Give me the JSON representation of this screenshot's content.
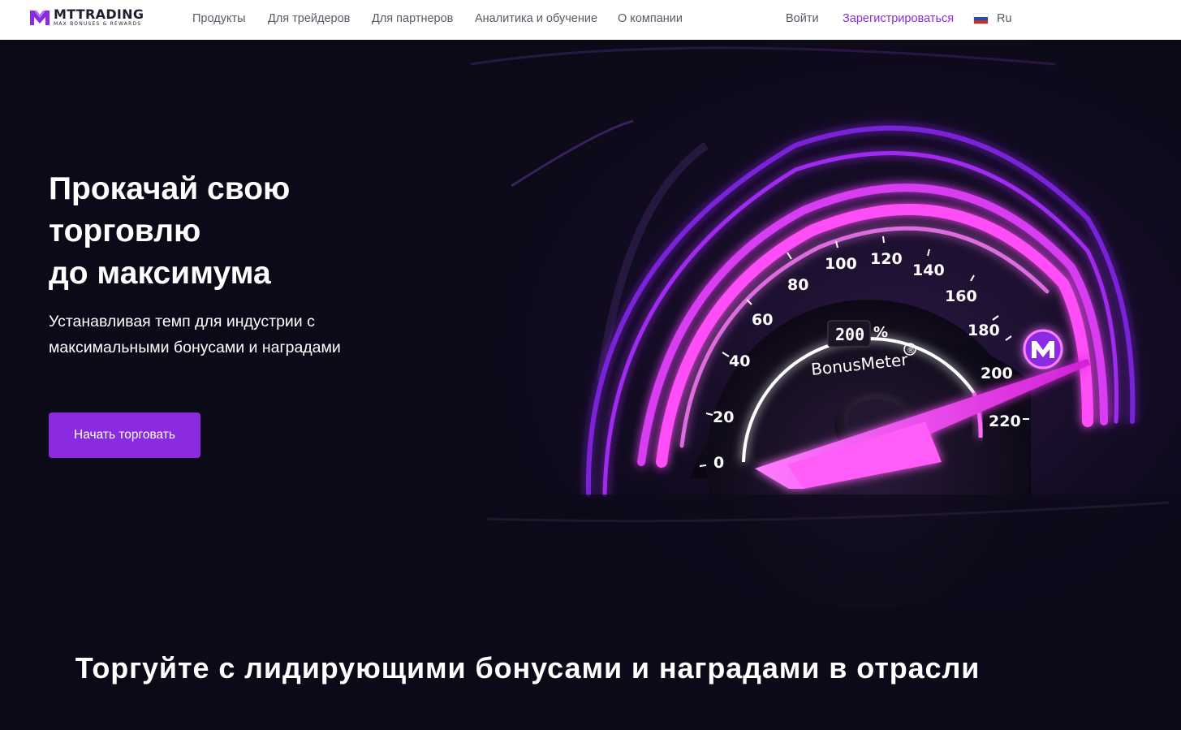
{
  "brand": {
    "name": "MTTRADING",
    "tagline": "MAX BONUSES & REWARDS"
  },
  "nav": {
    "items": [
      {
        "label": "Продукты"
      },
      {
        "label": "Для трейдеров"
      },
      {
        "label": "Для партнеров"
      },
      {
        "label": "Аналитика и обучение"
      },
      {
        "label": "О компании"
      }
    ],
    "login": "Войти",
    "register": "Зарегистрироваться",
    "language": "Ru",
    "language_flag_icon": "russia-flag-icon"
  },
  "hero": {
    "title_lines": [
      "Прокачай свою",
      "торговлю",
      "до максимума"
    ],
    "subtitle_lines": [
      "Устанавливая темп для индустрии с",
      "максимальными бонусами и наградами"
    ],
    "cta": "Начать торговать",
    "gauge": {
      "readout_value": "200",
      "readout_unit": "%",
      "brand": "BonusMeter",
      "trademark": "®",
      "ticks": [
        "0",
        "20",
        "40",
        "60",
        "80",
        "100",
        "120",
        "140",
        "160",
        "180",
        "200",
        "220"
      ]
    }
  },
  "section": {
    "title": "Торгуйте с лидирующими бонусами и наградами в отрасли"
  },
  "colors": {
    "accent": "#8a2be2",
    "hero_bg": "#0c0a18",
    "glow": "#ff3df5"
  }
}
